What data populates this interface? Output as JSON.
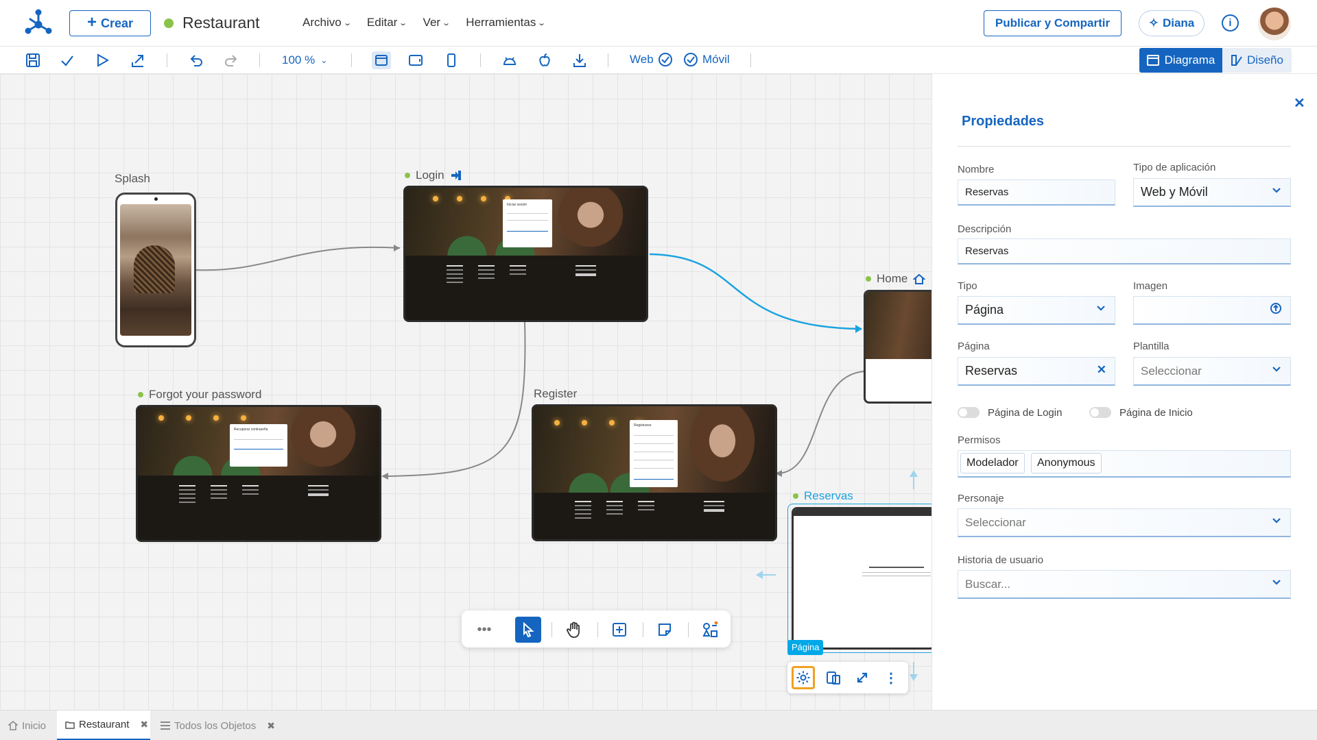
{
  "header": {
    "create_label": "Crear",
    "app_title": "Restaurant",
    "menu": [
      "Archivo",
      "Editar",
      "Ver",
      "Herramientas"
    ],
    "publish_label": "Publicar y Compartir",
    "assistant_label": "Diana"
  },
  "toolbar": {
    "zoom": "100 %",
    "web_label": "Web",
    "mobile_label": "Móvil",
    "view_diagram": "Diagrama",
    "view_design": "Diseño"
  },
  "canvas": {
    "nodes": {
      "splash": "Splash",
      "login": "Login",
      "home": "Home",
      "forgot": "Forgot your password",
      "register": "Register",
      "reservas": "Reservas"
    },
    "page_tag": "Página"
  },
  "panel": {
    "title": "Propiedades",
    "nombre_label": "Nombre",
    "nombre_value": "Reservas",
    "tipo_app_label": "Tipo de aplicación",
    "tipo_app_value": "Web y Móvil",
    "descripcion_label": "Descripción",
    "descripcion_value": "Reservas",
    "tipo_label": "Tipo",
    "tipo_value": "Página",
    "imagen_label": "Imagen",
    "pagina_label": "Página",
    "pagina_value": "Reservas",
    "plantilla_label": "Plantilla",
    "plantilla_placeholder": "Seleccionar",
    "login_toggle": "Página de Login",
    "inicio_toggle": "Página de Inicio",
    "permisos_label": "Permisos",
    "permisos": [
      "Modelador",
      "Anonymous"
    ],
    "personaje_label": "Personaje",
    "personaje_placeholder": "Seleccionar",
    "historia_label": "Historia de usuario",
    "historia_placeholder": "Buscar..."
  },
  "tabs": [
    {
      "label": "Inicio"
    },
    {
      "label": "Restaurant"
    },
    {
      "label": "Todos los Objetos"
    }
  ],
  "colors": {
    "accent": "#1565c0",
    "status_green": "#8bc34a",
    "connector_blue": "#1aa3e0",
    "connector_gray": "#888888"
  }
}
